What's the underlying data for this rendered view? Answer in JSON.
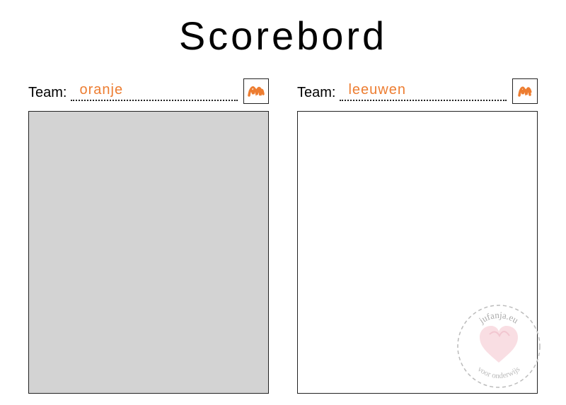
{
  "title": "Scorebord",
  "team_label": "Team:",
  "teams": [
    {
      "name": "oranje",
      "filled": true
    },
    {
      "name": "leeuwen",
      "filled": false
    }
  ],
  "accent_color": "#ed7d31",
  "watermark": {
    "top_text": "jufanja.eu",
    "bottom_text": "voor onderwijs"
  }
}
